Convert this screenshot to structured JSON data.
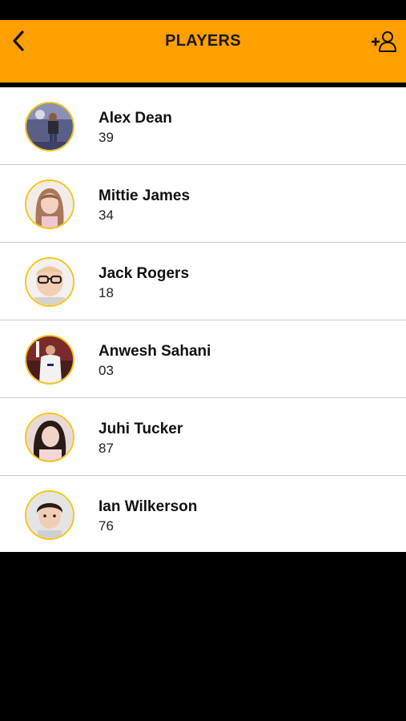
{
  "header": {
    "title": "PLAYERS",
    "back_icon": "chevron-left-icon",
    "add_icon": "add-user-icon",
    "background": "#FF9F00"
  },
  "players": [
    {
      "name": "Alex Dean",
      "number": "39"
    },
    {
      "name": "Mittie James",
      "number": "34"
    },
    {
      "name": "Jack Rogers",
      "number": "18"
    },
    {
      "name": "Anwesh Sahani",
      "number": "03"
    },
    {
      "name": "Juhi Tucker",
      "number": "87"
    },
    {
      "name": "Ian Wilkerson",
      "number": "76"
    }
  ],
  "colors": {
    "accent": "#FF9F00",
    "avatar_ring": "#F5C518",
    "divider": "#C9C9C9"
  }
}
